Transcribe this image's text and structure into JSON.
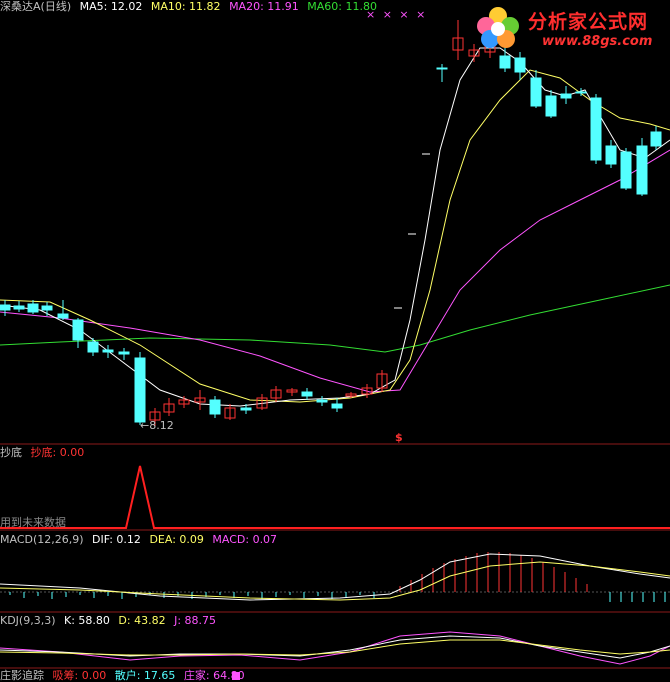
{
  "main_panel": {
    "stock_name": "深桑达A",
    "period": "(日线)",
    "ma_labels": [
      {
        "label": "MA5: 12.02",
        "color": "#ffffff"
      },
      {
        "label": "MA10: 11.82",
        "color": "#ffff66"
      },
      {
        "label": "MA20: 11.91",
        "color": "#ff55ff"
      },
      {
        "label": "MA60: 11.80",
        "color": "#33dd33"
      }
    ],
    "low_price_annotation": "8.12",
    "signal_marker": "$",
    "x_markers": "× × × ×"
  },
  "chaodi_panel": {
    "title": "抄底",
    "value_label": "抄底: 0.00",
    "note": "用到未来数据"
  },
  "macd_panel": {
    "title": "MACD(12,26,9)",
    "dif": "DIF: 0.12",
    "dea": "DEA: 0.09",
    "macd": "MACD: 0.07"
  },
  "kdj_panel": {
    "title": "KDJ(9,3,3)",
    "k": "K: 58.80",
    "d": "D: 43.82",
    "j": "J: 88.75"
  },
  "zhuying_panel": {
    "title": "庄影追踪",
    "xishou": "吸筹: 0.00",
    "sanhu": "散户: 17.65",
    "zhuangjia": "庄家: 64.80"
  },
  "logo": {
    "name": "分析家公式网",
    "url": "www.88gs.com"
  },
  "colors": {
    "up": "#ff3333",
    "down": "#54ffff",
    "ma5": "#ffffff",
    "ma10": "#ffff66",
    "ma20": "#ff55ff",
    "ma60": "#33dd33",
    "divider": "#8b1a1a"
  }
}
